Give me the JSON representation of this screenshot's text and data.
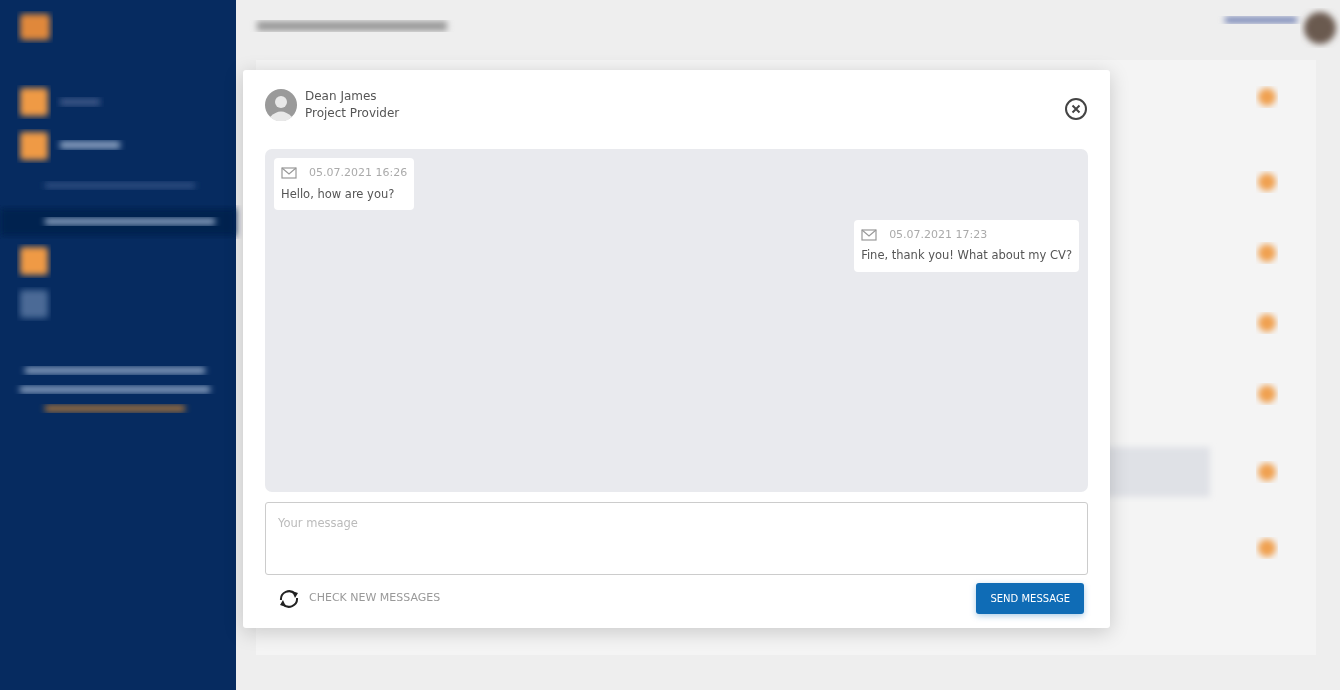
{
  "dialog": {
    "contact": {
      "name": "Dean James",
      "role": "Project Provider"
    },
    "messages": [
      {
        "kind": "incoming",
        "time": "05.07.2021 16:26",
        "text": "Hello, how are you?"
      },
      {
        "kind": "outgoing",
        "time": "05.07.2021 17:23",
        "text": "Fine, thank you! What about my CV?"
      }
    ],
    "composer": {
      "placeholder": "Your message"
    },
    "check_button": "CHECK NEW MESSAGES",
    "send_button": "SEND MESSAGE"
  }
}
